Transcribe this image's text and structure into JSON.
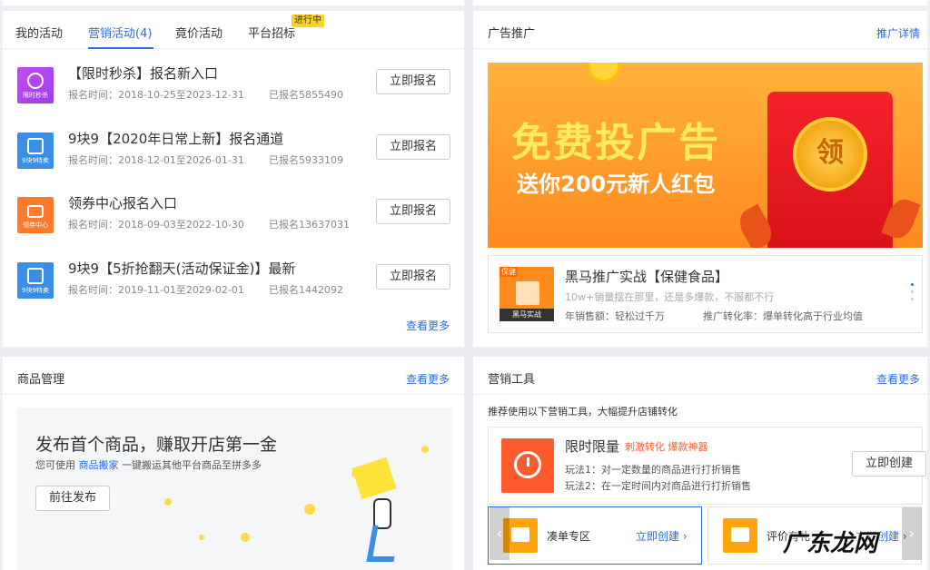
{
  "activities": {
    "tabs": [
      {
        "label": "我的活动"
      },
      {
        "label": "营销活动(4)"
      },
      {
        "label": "竟价活动"
      },
      {
        "label": "平台招标"
      }
    ],
    "live_badge": "进行中",
    "items": [
      {
        "icon_caption": "限时秒杀",
        "title": "【限时秒杀】报名新入口",
        "time": "报名时间：2018-10-25至2023-12-31",
        "count": "已报名5855490",
        "button": "立即报名",
        "icon": "alarm-clock-icon"
      },
      {
        "icon_caption": "9块9特卖",
        "title": "9块9【2020年日常上新】报名通道",
        "time": "报名时间：2018-12-01至2026-01-31",
        "count": "已报名5933109",
        "button": "立即报名",
        "icon": "nine-nine-icon"
      },
      {
        "icon_caption": "领券中心",
        "title": "领券中心报名入口",
        "time": "报名时间：2018-09-03至2022-10-30",
        "count": "已报名13637031",
        "button": "立即报名",
        "icon": "coupon-icon"
      },
      {
        "icon_caption": "9块9特卖",
        "title": "9块9【5折抢翻天(活动保证金)】最新",
        "time": "报名时间：2019-11-01至2029-02-01",
        "count": "已报名1442092",
        "button": "立即报名",
        "icon": "nine-nine-icon"
      }
    ],
    "more_link": "查看更多"
  },
  "ad": {
    "title": "广告推广",
    "detail_link": "推广详情",
    "banner_title": "免费投广告",
    "banner_subtitle": "送你200元新人红包",
    "coin_text": "领",
    "promo": {
      "tag": "保健",
      "img_caption": "黑马实战",
      "title": "黑马推广实战【保健食品】",
      "desc": "10w+销量摆在那里，还是多爆款，不服都不行",
      "stat1": "年销售额：轻松过千万",
      "stat2": "推广转化率：爆单转化高于行业均值"
    }
  },
  "goods": {
    "title": "商品管理",
    "more_link": "查看更多",
    "headline": "发布首个商品，赚取开店第一金",
    "desc_pre": "您可使用",
    "desc_link": "商品搬家",
    "desc_post": "一键搬运其他平台商品至拼多多",
    "button": "前往发布"
  },
  "tools": {
    "title": "营销工具",
    "more_link": "查看更多",
    "intro": "推荐使用以下营销工具，大幅提升店铺转化",
    "main": {
      "title": "限时限量",
      "tags": "刺激转化 爆款神器",
      "rule1": "玩法1：对一定数量的商品进行打折销售",
      "rule2": "玩法2：在一定时间内对商品进行打折销售",
      "button": "立即创建"
    },
    "mini1": {
      "label": "凑单专区",
      "link": "立即创建 ›"
    },
    "mini2": {
      "label": "评价有礼",
      "link": "立即创建 ›"
    }
  },
  "watermark": "广东龙网",
  "colors": {
    "accent": "#2b6de5",
    "orange": "#ff5a2c"
  }
}
